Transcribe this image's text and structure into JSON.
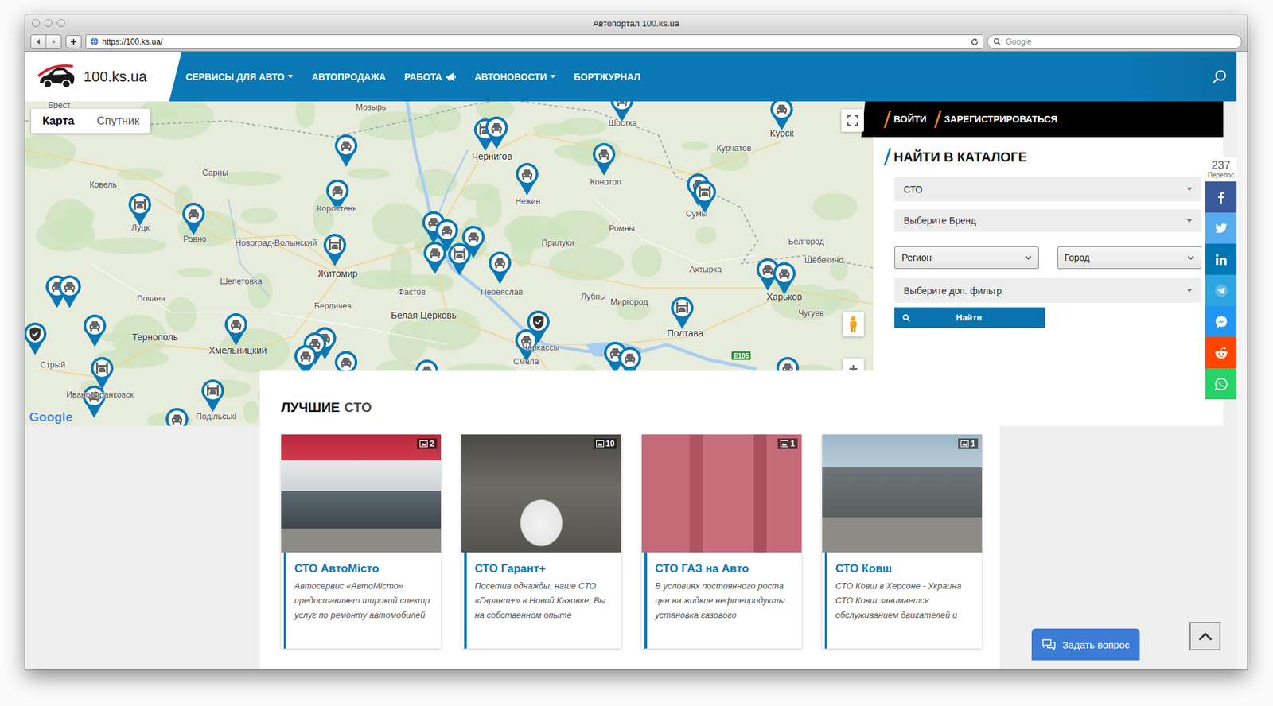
{
  "window": {
    "title": "Автопортал 100.ks.ua"
  },
  "toolbar": {
    "url": "https://100.ks.ua/",
    "search_placeholder": "Google"
  },
  "site": {
    "logo": "100.ks.ua",
    "nav": [
      {
        "label": "СЕРВИСЫ ДЛЯ АВТО",
        "kind": "dropdown"
      },
      {
        "label": "АВТОПРОДАЖА",
        "kind": "link"
      },
      {
        "label": "РАБОТА",
        "kind": "megaphone"
      },
      {
        "label": "АВТОНОВОСТИ",
        "kind": "dropdown"
      },
      {
        "label": "БОРТЖУРНАЛ",
        "kind": "link"
      }
    ]
  },
  "map": {
    "tabs": [
      {
        "label": "Карта",
        "selected": true
      },
      {
        "label": "Спутник",
        "selected": false
      }
    ],
    "labels": [
      "Брест",
      "Мозырь",
      "Шостка",
      "Курск",
      "Чернигов",
      "Курчатов",
      "Ковель",
      "Сарны",
      "Луцк",
      "Ровно",
      "Коростень",
      "Нежин",
      "Конотоп",
      "Сумы",
      "Ромны",
      "Новоград-Волынский",
      "Прилуки",
      "Белгород",
      "Житомир",
      "Шепетовка",
      "Фастов",
      "Переяслав",
      "Ахтырка",
      "Шебекино",
      "Харьков",
      "Почаев",
      "Бердичев",
      "Белая Церковь",
      "Лубны",
      "Миргород",
      "Чугуев",
      "Тернополь",
      "Хмельницкий",
      "Полтава",
      "Стрый",
      "Ивано-Франковск",
      "Черкассы",
      "Смела",
      "Подільські"
    ],
    "road": "E105",
    "attribution": "Google",
    "pins": [
      {
        "kind": "service"
      },
      {
        "kind": "service"
      },
      {
        "kind": "lift"
      },
      {
        "kind": "service"
      },
      {
        "kind": "lift"
      },
      {
        "kind": "lift"
      },
      {
        "kind": "service"
      },
      {
        "kind": "service"
      },
      {
        "kind": "service"
      },
      {
        "kind": "service"
      },
      {
        "kind": "service"
      },
      {
        "kind": "service"
      },
      {
        "kind": "lift"
      },
      {
        "kind": "service"
      },
      {
        "kind": "service"
      },
      {
        "kind": "service"
      },
      {
        "kind": "service"
      },
      {
        "kind": "lift"
      },
      {
        "kind": "service"
      },
      {
        "kind": "service"
      },
      {
        "kind": "service"
      },
      {
        "kind": "service"
      },
      {
        "kind": "service"
      },
      {
        "kind": "verified"
      },
      {
        "kind": "service"
      },
      {
        "kind": "lift"
      },
      {
        "kind": "service"
      },
      {
        "kind": "service"
      },
      {
        "kind": "service"
      },
      {
        "kind": "service"
      },
      {
        "kind": "service"
      },
      {
        "kind": "service"
      },
      {
        "kind": "verified"
      },
      {
        "kind": "service"
      },
      {
        "kind": "service"
      },
      {
        "kind": "service"
      },
      {
        "kind": "lift"
      },
      {
        "kind": "lift"
      },
      {
        "kind": "service"
      },
      {
        "kind": "service"
      },
      {
        "kind": "service"
      }
    ]
  },
  "auth": {
    "login": "ВОЙТИ",
    "register": "ЗАРЕГИСТРИРОВАТЬСЯ"
  },
  "catalog": {
    "title": "НАЙТИ В КАТАЛОГЕ",
    "selects": [
      {
        "value": "СТО",
        "kind": "flat"
      },
      {
        "value": "Выберите Бренд",
        "kind": "flat"
      },
      {
        "value": "Регион",
        "kind": "native"
      },
      {
        "value": "Город",
        "kind": "native"
      },
      {
        "value": "Выберите доп. фильтр",
        "kind": "flat"
      }
    ],
    "button": "Найти"
  },
  "share": {
    "count": "237",
    "label": "Перепос",
    "networks": [
      {
        "kind": "facebook",
        "color": "#3b5998"
      },
      {
        "kind": "twitter",
        "color": "#55acee"
      },
      {
        "kind": "linkedin",
        "color": "#0077b5"
      },
      {
        "kind": "telegram",
        "color": "#2ca5e0"
      },
      {
        "kind": "messenger",
        "color": "#2196f3"
      },
      {
        "kind": "reddit",
        "color": "#ff4500"
      },
      {
        "kind": "whatsapp",
        "color": "#25d366"
      }
    ]
  },
  "best": {
    "title": "ЛУЧШИЕ",
    "accent": "СТО",
    "cards": [
      {
        "title": "СТО АвтоМісто",
        "description": "Автосервис «АвтоМісто» предоставляет широкий спектр услуг по ремонту автомобилей",
        "photos": "2"
      },
      {
        "title": "СТО Гарант+",
        "description": "Посетив однажды, наше СТО «Гарант+» в Новой Каховке, Вы на собственном опыте",
        "photos": "10"
      },
      {
        "title": "СТО ГАЗ на Авто",
        "description": "В условиях постоянного роста цен на жидкие нефтепродукты установка газового",
        "photos": "1"
      },
      {
        "title": "СТО Ковш",
        "description": "СТО Ковш в Херсоне - Украина СТО Ковш занимается обслуживанием двигателей и",
        "photos": "1"
      }
    ]
  },
  "chat": {
    "label": "Задать вопрос"
  }
}
